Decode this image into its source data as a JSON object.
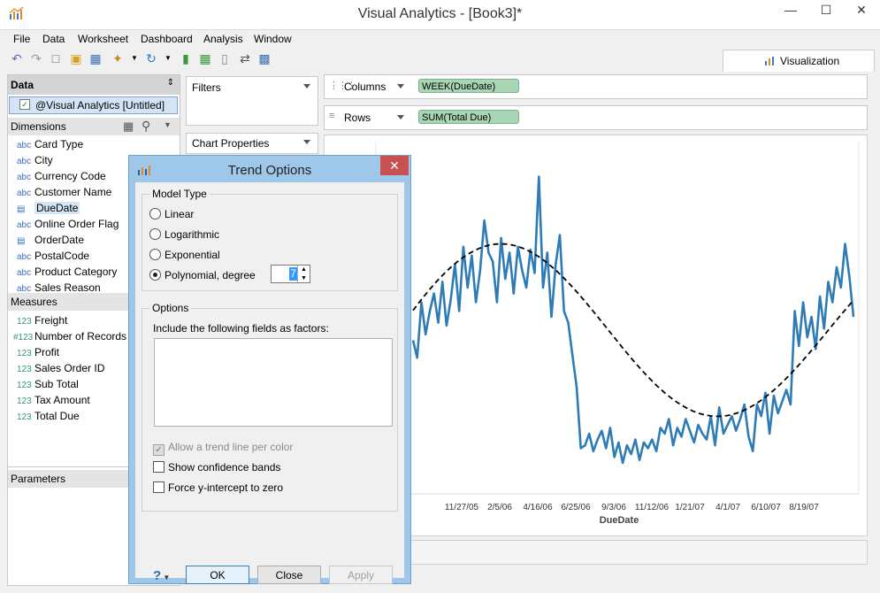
{
  "window": {
    "title": "Visual Analytics - [Book3]*"
  },
  "menu": [
    "File",
    "Data",
    "Worksheet",
    "Dashboard",
    "Analysis",
    "Window"
  ],
  "tabs": {
    "visualization": "Visualization"
  },
  "data_panel": {
    "header": "Data",
    "source": "@Visual Analytics [Untitled]",
    "dimensions_header": "Dimensions",
    "dimensions": [
      {
        "type": "abc",
        "label": "Card Type"
      },
      {
        "type": "abc",
        "label": "City"
      },
      {
        "type": "abc",
        "label": "Currency Code"
      },
      {
        "type": "abc",
        "label": "Customer Name"
      },
      {
        "type": "date",
        "label": "DueDate"
      },
      {
        "type": "abc",
        "label": "Online Order Flag"
      },
      {
        "type": "date",
        "label": "OrderDate"
      },
      {
        "type": "abc",
        "label": "PostalCode"
      },
      {
        "type": "abc",
        "label": "Product Category"
      },
      {
        "type": "abc",
        "label": "Sales Reason"
      }
    ],
    "measures_header": "Measures",
    "measures": [
      {
        "type": "123",
        "label": "Freight"
      },
      {
        "type": "#123",
        "label": "Number of Records"
      },
      {
        "type": "123",
        "label": "Profit"
      },
      {
        "type": "123",
        "label": "Sales Order ID"
      },
      {
        "type": "123",
        "label": "Sub Total"
      },
      {
        "type": "123",
        "label": "Tax Amount"
      },
      {
        "type": "123",
        "label": "Total Due"
      }
    ],
    "parameters_header": "Parameters"
  },
  "filters": {
    "label": "Filters"
  },
  "chart_properties": {
    "label": "Chart Properties"
  },
  "shelves": {
    "columns_label": "Columns",
    "columns_pill": "WEEK(DueDate)",
    "rows_label": "Rows",
    "rows_pill": "SUM(Total Due)"
  },
  "dialog": {
    "title": "Trend Options",
    "model_type_label": "Model Type",
    "models": [
      "Linear",
      "Logarithmic",
      "Exponential",
      "Polynomial, degree"
    ],
    "selected_model": "Polynomial, degree",
    "degree": "7",
    "options_label": "Options",
    "factors_label": "Include the following fields as factors:",
    "allow_trend_per_color": "Allow a trend line per color",
    "show_confidence_bands": "Show confidence bands",
    "force_y_intercept": "Force y-intercept to zero",
    "help": "?",
    "ok": "OK",
    "close": "Close",
    "apply": "Apply"
  },
  "colors": {
    "line": "#2e7bb6",
    "trend": "#000000",
    "pill": "#a8d5b4",
    "dialog_frame": "#9fc7ea",
    "close_red": "#c75050"
  },
  "chart_data": {
    "type": "line",
    "xlabel": "DueDate",
    "x_ticks": [
      "11/27/05",
      "2/5/06",
      "4/16/06",
      "6/25/06",
      "9/3/06",
      "11/12/06",
      "1/21/07",
      "4/1/07",
      "6/10/07",
      "8/19/07"
    ],
    "series": [
      {
        "values": [
          0.42,
          0.36,
          0.55,
          0.44,
          0.52,
          0.58,
          0.48,
          0.62,
          0.47,
          0.56,
          0.68,
          0.52,
          0.74,
          0.6,
          0.71,
          0.55,
          0.66,
          0.83,
          0.72,
          0.69,
          0.55,
          0.77,
          0.63,
          0.72,
          0.58,
          0.74,
          0.66,
          0.6,
          0.73,
          0.65,
          0.98,
          0.6,
          0.72,
          0.5,
          0.68,
          0.78,
          0.52,
          0.48,
          0.37,
          0.26,
          0.05,
          0.06,
          0.1,
          0.04,
          0.08,
          0.11,
          0.05,
          0.12,
          0.02,
          0.07,
          0.0,
          0.06,
          0.03,
          0.08,
          0.01,
          0.07,
          0.05,
          0.08,
          0.04,
          0.12,
          0.1,
          0.15,
          0.06,
          0.12,
          0.09,
          0.15,
          0.11,
          0.07,
          0.13,
          0.1,
          0.08,
          0.16,
          0.06,
          0.19,
          0.1,
          0.13,
          0.16,
          0.11,
          0.15,
          0.2,
          0.09,
          0.04,
          0.2,
          0.16,
          0.24,
          0.1,
          0.23,
          0.17,
          0.21,
          0.25,
          0.2,
          0.52,
          0.4,
          0.55,
          0.43,
          0.5,
          0.39,
          0.57,
          0.46,
          0.62,
          0.55,
          0.67,
          0.6,
          0.75,
          0.64,
          0.5
        ]
      }
    ],
    "trend": {
      "model": "polynomial",
      "degree": 7
    }
  }
}
